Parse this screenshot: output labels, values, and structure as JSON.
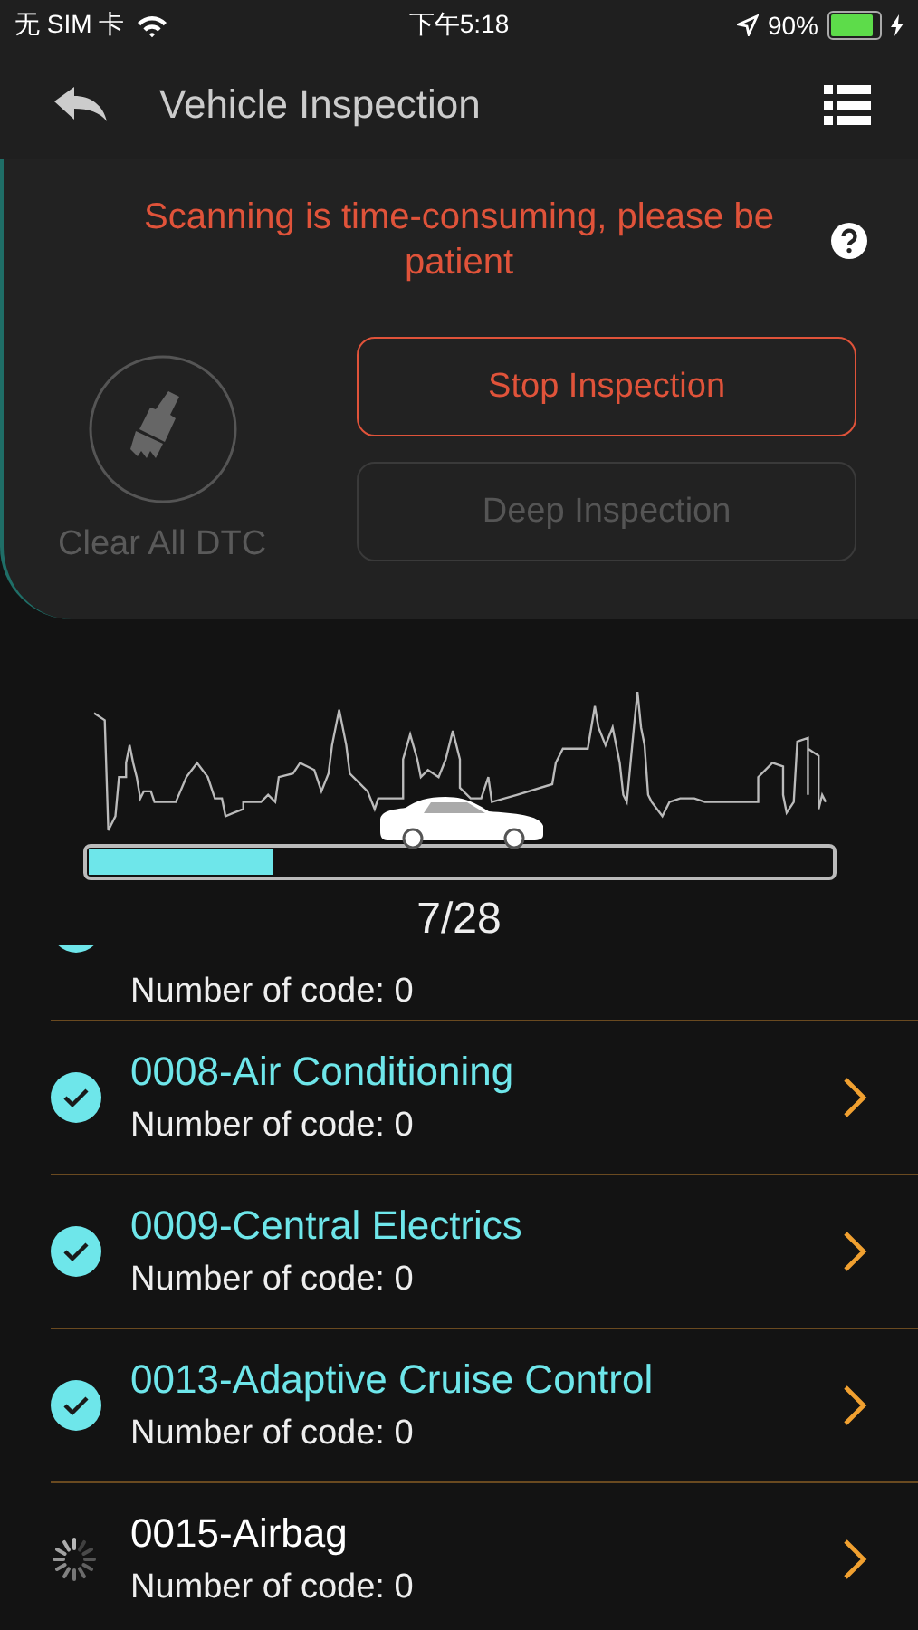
{
  "status_bar": {
    "carrier": "无 SIM 卡",
    "time": "下午5:18",
    "battery": "90%"
  },
  "nav": {
    "title": "Vehicle Inspection"
  },
  "notice": "Scanning is time-consuming, please be patient",
  "clear_button": {
    "label": "Clear All DTC",
    "disabled": true
  },
  "actions": [
    {
      "label": "Stop Inspection",
      "disabled": false
    },
    {
      "label": "Deep Inspection",
      "disabled": true
    }
  ],
  "progress": {
    "level": 0.25,
    "reading": "7/28"
  },
  "modules": [
    {
      "count": "Number of code: 0",
      "scanned": true
    },
    {
      "name": "0008-Air Conditioning",
      "count": "Number of code: 0",
      "scanned": true
    },
    {
      "name": "0009-Central Electrics",
      "count": "Number of code: 0",
      "scanned": true
    },
    {
      "name": "0013-Adaptive Cruise Control",
      "count": "Number of code: 0",
      "scanned": true
    },
    {
      "name": "0015-Airbag",
      "count": "Number of code: 0",
      "scanned": false
    }
  ]
}
